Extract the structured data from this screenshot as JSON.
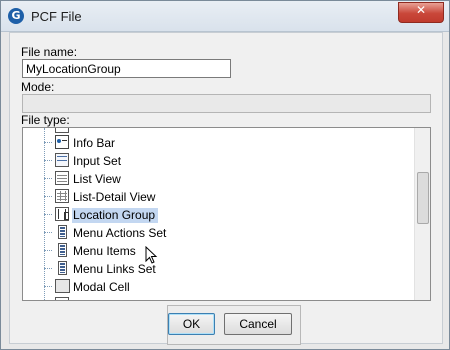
{
  "window": {
    "title": "PCF File",
    "app_icon_letter": "G",
    "close_glyph": "✕"
  },
  "form": {
    "file_name_label": "File name:",
    "file_name_value": "MyLocationGroup",
    "mode_label": "Mode:",
    "mode_value": "",
    "file_type_label": "File type:"
  },
  "file_types": [
    {
      "label": "Info Bar",
      "icon": "info-bar-icon"
    },
    {
      "label": "Input Set",
      "icon": "input-set-icon"
    },
    {
      "label": "List View",
      "icon": "list-view-icon"
    },
    {
      "label": "List-Detail View",
      "icon": "list-detail-view-icon"
    },
    {
      "label": "Location Group",
      "icon": "location-group-icon",
      "selected": true
    },
    {
      "label": "Menu Actions Set",
      "icon": "menu-actions-set-icon"
    },
    {
      "label": "Menu Items",
      "icon": "menu-items-icon"
    },
    {
      "label": "Menu Links Set",
      "icon": "menu-links-set-icon"
    },
    {
      "label": "Modal Cell",
      "icon": "modal-cell-icon"
    }
  ],
  "buttons": {
    "ok_label": "OK",
    "cancel_label": "Cancel"
  },
  "colors": {
    "selection": "#c3d7f1",
    "close_button": "#c9473a",
    "app_icon": "#1d5fa8"
  }
}
